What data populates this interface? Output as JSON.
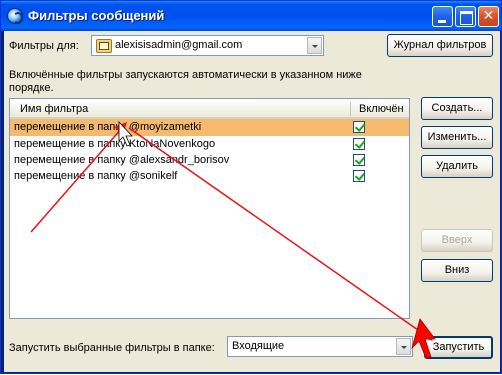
{
  "window": {
    "title": "Фильтры сообщений"
  },
  "filters_for": {
    "label": "Фильтры для:",
    "account": "alexisisadmin@gmail.com"
  },
  "buttons": {
    "journal": "Журнал фильтров",
    "create": "Создать...",
    "edit": "Изменить...",
    "delete": "Удалить",
    "up": "Вверх",
    "down": "Вниз",
    "run": "Запустить"
  },
  "info_text": {
    "line1": "Включённые фильтры запускаются автоматически в указанном ниже",
    "line2": "порядке."
  },
  "list": {
    "columns": [
      "Имя фильтра",
      "Включён"
    ],
    "rows": [
      {
        "name": "перемещение в папку @moyizametki",
        "enabled": true,
        "selected": true
      },
      {
        "name": "перемещение в папку KtoNaNovenkogo",
        "enabled": true,
        "selected": false
      },
      {
        "name": "перемещение в папку @alexsandr_borisov",
        "enabled": true,
        "selected": false
      },
      {
        "name": "перемещение в папку @sonikelf",
        "enabled": true,
        "selected": false
      }
    ]
  },
  "run_in_folder": {
    "label": "Запустить выбранные фильтры в папке:",
    "folder": "Входящие"
  },
  "annotations": {
    "arrow_color": "#e8141b"
  }
}
